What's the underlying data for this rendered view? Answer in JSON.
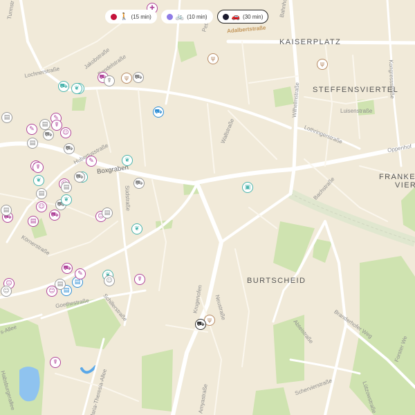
{
  "legend": [
    {
      "color": "#c4123b",
      "icon": "walking-person-icon",
      "glyph": "🚶",
      "label": "(15 min)",
      "active": false
    },
    {
      "color": "#8f7ce6",
      "icon": "bicycle-icon",
      "glyph": "🚲",
      "label": "(10 min)",
      "active": false
    },
    {
      "color": "#1a1a2e",
      "icon": "car-icon",
      "glyph": "🚗",
      "label": "(30 min)",
      "active": true
    }
  ],
  "districts": {
    "kaiserplatz": "KAISERPLATZ",
    "steffensviertel": "STEFFENSVIERTEL",
    "frankenberger": "FRANKEN",
    "frankenberger_2": "VIER",
    "burtscheid": "BURTSCHEID"
  },
  "streets": {
    "adalbertstrasse": "Adalbertstraße",
    "turmstrasse": "Turmstr",
    "bahnhofstrasse": "Bahnhof",
    "peterstrasse": "Peterstr",
    "jakobstrasse": "Jakobstraße",
    "bendelstrasse": "Bendelstraße",
    "lochnerstrasse": "Lochnerstraße",
    "boxgraben": "Boxgraben",
    "hubertusstrasse": "Hubertusstraße",
    "suedstrasse": "Südstraße",
    "wallstrasse": "Wallstraße",
    "wilhelmstrasse": "Wilhelmstraße",
    "luisenstrasse": "Luisenstraße",
    "lothringerstrasse": "Lothringerstraße",
    "oppenhoffallee": "Oppenhof",
    "bachstrasse": "Bachstraße",
    "kongressstrasse": "Kongressstraße",
    "goethestrasse": "Goethestraße",
    "schillerstrasse": "Schillerstraße",
    "krugenofen": "Krugenofen",
    "neustrasse": "Neustraße",
    "abteistrasse": "Abteistraße",
    "branderhofer_weg": "Branderhofer Weg",
    "schervierstrasse": "Schervierstraße",
    "forster_weg": "Forster We",
    "lutzowstrasse": "Lützowstraße",
    "maria_theresia_allee": "Maria-Theresia-Allee",
    "amyastrasse": "Amyastraße",
    "weg_left": "s-Allee",
    "kornerstrasse": "Körnerstraße",
    "habsburger": "Habsburgerallee"
  },
  "pois": [
    {
      "icon": "hospital-icon",
      "glyph": "✚",
      "tone": "pink"
    },
    {
      "icon": "restaurant-icon",
      "glyph": "ψ",
      "tone": "brown"
    },
    {
      "icon": "restaurant-icon",
      "glyph": "ψ",
      "tone": "brown"
    },
    {
      "icon": "restaurant-icon",
      "glyph": "ψ",
      "tone": "brown"
    },
    {
      "icon": "restaurant-icon",
      "glyph": "ψ",
      "tone": "brown"
    },
    {
      "icon": "pharmacy-icon",
      "glyph": "✚",
      "tone": "teal"
    },
    {
      "icon": "shopping-cart-icon",
      "glyph": "⛟",
      "tone": "blue"
    },
    {
      "icon": "shopping-cart-icon",
      "glyph": "⛟",
      "tone": "teal"
    },
    {
      "icon": "leaf-icon",
      "glyph": "❦",
      "tone": "teal"
    },
    {
      "icon": "leaf-icon",
      "glyph": "❦",
      "tone": "teal"
    },
    {
      "icon": "leaf-icon",
      "glyph": "❦",
      "tone": "teal"
    },
    {
      "icon": "leaf-icon",
      "glyph": "❦",
      "tone": "teal"
    },
    {
      "icon": "leaf-icon",
      "glyph": "❦",
      "tone": "teal"
    },
    {
      "icon": "train-icon",
      "glyph": "▣",
      "tone": "teal"
    },
    {
      "icon": "bus-icon",
      "glyph": "▤",
      "tone": "teal"
    },
    {
      "icon": "bus-icon",
      "glyph": "▤",
      "tone": "blue"
    },
    {
      "icon": "bus-icon",
      "glyph": "▤",
      "tone": "blue"
    },
    {
      "icon": "bus-icon",
      "glyph": "▤",
      "tone": "pink"
    },
    {
      "icon": "school-icon",
      "glyph": "✎",
      "tone": "pink"
    },
    {
      "icon": "school-icon",
      "glyph": "✎",
      "tone": "pink"
    },
    {
      "icon": "school-icon",
      "glyph": "✎",
      "tone": "pink"
    },
    {
      "icon": "school-icon",
      "glyph": "✎",
      "tone": "pink"
    },
    {
      "icon": "kindergarten-icon",
      "glyph": "☺",
      "tone": "pink"
    },
    {
      "icon": "kindergarten-icon",
      "glyph": "☺",
      "tone": "pink"
    },
    {
      "icon": "kindergarten-icon",
      "glyph": "☺",
      "tone": "pink"
    },
    {
      "icon": "kindergarten-icon",
      "glyph": "☺",
      "tone": "pink"
    },
    {
      "icon": "kindergarten-icon",
      "glyph": "☺",
      "tone": "pink"
    },
    {
      "icon": "kindergarten-icon",
      "glyph": "☺",
      "tone": "pink"
    },
    {
      "icon": "kindergarten-icon",
      "glyph": "☺",
      "tone": "pink"
    },
    {
      "icon": "doctor-icon",
      "glyph": "☤",
      "tone": "pink"
    },
    {
      "icon": "doctor-icon",
      "glyph": "☤",
      "tone": "pink"
    },
    {
      "icon": "doctor-icon",
      "glyph": "☤",
      "tone": "pink"
    },
    {
      "icon": "doctor-icon",
      "glyph": "☤",
      "tone": "pink"
    },
    {
      "icon": "shopping-cart-icon",
      "glyph": "⛟",
      "tone": "pink"
    },
    {
      "icon": "shopping-cart-icon",
      "glyph": "⛟",
      "tone": "pink"
    },
    {
      "icon": "shopping-cart-icon",
      "glyph": "⛟",
      "tone": "pink"
    },
    {
      "icon": "shopping-cart-icon",
      "glyph": "⛟",
      "tone": "pink"
    },
    {
      "icon": "shopping-cart-icon",
      "glyph": "⛟",
      "tone": "grey"
    },
    {
      "icon": "shopping-cart-icon",
      "glyph": "⛟",
      "tone": "grey"
    },
    {
      "icon": "shopping-cart-icon",
      "glyph": "⛟",
      "tone": "grey"
    },
    {
      "icon": "shopping-cart-icon",
      "glyph": "⛟",
      "tone": "grey"
    },
    {
      "icon": "shopping-cart-icon",
      "glyph": "⛟",
      "tone": "grey"
    },
    {
      "icon": "shopping-cart-icon",
      "glyph": "⛟",
      "tone": "grey"
    },
    {
      "icon": "bus-icon",
      "glyph": "▤",
      "tone": "grey"
    },
    {
      "icon": "bus-icon",
      "glyph": "▤",
      "tone": "grey"
    },
    {
      "icon": "bus-icon",
      "glyph": "▤",
      "tone": "grey"
    },
    {
      "icon": "bus-icon",
      "glyph": "▤",
      "tone": "grey"
    },
    {
      "icon": "bus-icon",
      "glyph": "▤",
      "tone": "grey"
    },
    {
      "icon": "bus-icon",
      "glyph": "▤",
      "tone": "grey"
    },
    {
      "icon": "bus-icon",
      "glyph": "▤",
      "tone": "grey"
    },
    {
      "icon": "kindergarten-icon",
      "glyph": "☺",
      "tone": "grey"
    },
    {
      "icon": "kindergarten-icon",
      "glyph": "☺",
      "tone": "grey"
    },
    {
      "icon": "doctor-icon",
      "glyph": "☤",
      "tone": "grey"
    },
    {
      "icon": "shopping-cart-icon",
      "glyph": "⛟",
      "tone": "dark"
    },
    {
      "icon": "leaf-icon",
      "glyph": "❦",
      "tone": "teal"
    },
    {
      "icon": "bus-icon",
      "glyph": "▤",
      "tone": "grey"
    }
  ]
}
